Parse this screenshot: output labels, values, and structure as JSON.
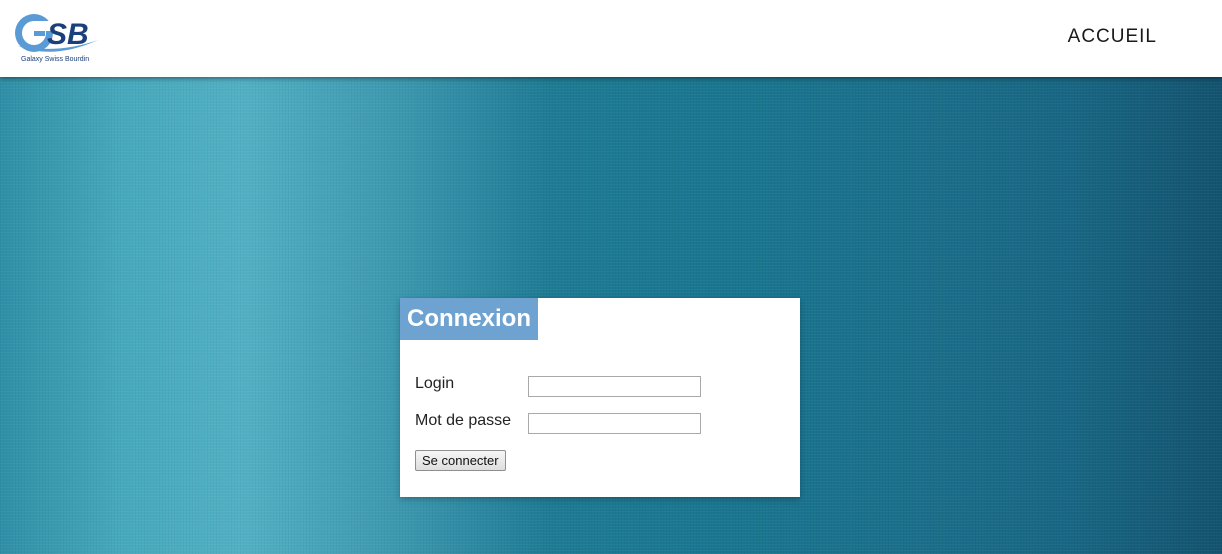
{
  "header": {
    "logo": {
      "letters": "GSB",
      "tagline": "Galaxy Swiss Bourdin",
      "icon": "gsb-logo"
    },
    "nav": {
      "accueil_label": "ACCUEIL"
    }
  },
  "login": {
    "title": "Connexion",
    "login_label": "Login",
    "login_value": "",
    "password_label": "Mot de passe",
    "password_value": "",
    "submit_label": "Se connecter"
  },
  "colors": {
    "title_bg": "#6ea3d1",
    "logo_blue": "#1b3f7a",
    "logo_light_blue": "#5b9bd5"
  }
}
